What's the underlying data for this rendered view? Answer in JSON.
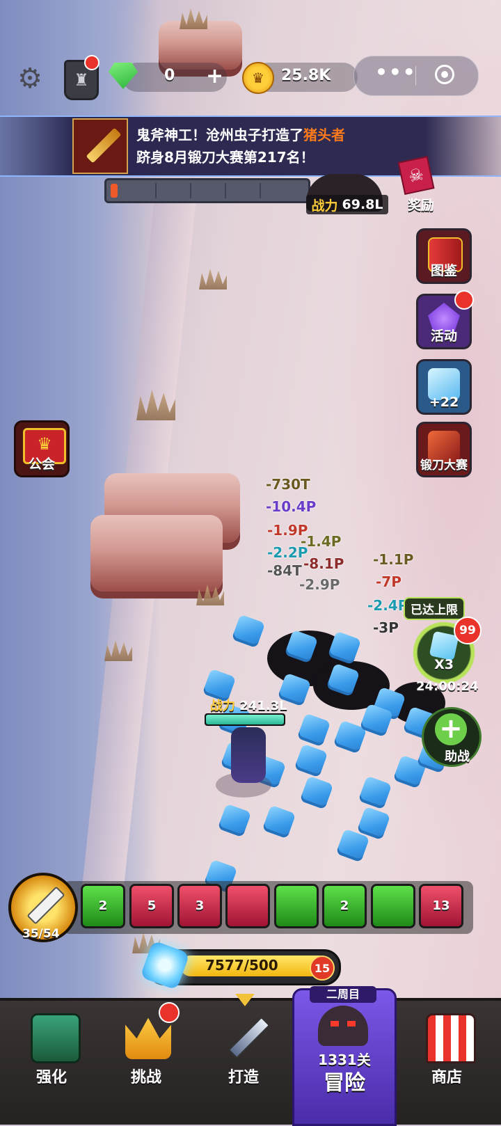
{
  "topbar": {
    "gems": "0",
    "gold": "25.8K"
  },
  "banner": {
    "line1_pre": "鬼斧神工！沧州虫子打造了",
    "line1_item": "猪头者",
    "line2": "跻身8月锻刀大赛第217名！"
  },
  "boss": {
    "power_label": "战力",
    "power_value": "69.8L",
    "reward_label": "奖励"
  },
  "side_buttons": {
    "codex": "图鉴",
    "events": "活动",
    "cubes_count": "+22",
    "forge_contest": "锻刀大赛",
    "guild": "公会"
  },
  "damage_numbers": [
    {
      "text": "-730T",
      "color": "#6b5a22"
    },
    {
      "text": "-10.4P",
      "color": "#6a3cc8"
    },
    {
      "text": "-1.9P",
      "color": "#c0392b"
    },
    {
      "text": "-1.4P",
      "color": "#6b6b22"
    },
    {
      "text": "-2.2P",
      "color": "#1c9ab0"
    },
    {
      "text": "-8.1P",
      "color": "#8e2c2c"
    },
    {
      "text": "-84T",
      "color": "#555555"
    },
    {
      "text": "-2.9P",
      "color": "#6a6a6a"
    },
    {
      "text": "-1.1P",
      "color": "#6b5a22"
    },
    {
      "text": "-7P",
      "color": "#c0392b"
    },
    {
      "text": "-2.4P",
      "color": "#1c9ab0"
    },
    {
      "text": "-3P",
      "color": "#333333"
    }
  ],
  "boost": {
    "cap_label": "已达上限",
    "multiplier": "X3",
    "badge": "99",
    "timer": "24:00:24",
    "assist_label": "助战"
  },
  "hero": {
    "power_label": "战力",
    "power_value": "241.3L",
    "hp_fraction": 1.0
  },
  "weapon": {
    "count": "35/54"
  },
  "skills": [
    {
      "type": "green",
      "level": "2"
    },
    {
      "type": "red",
      "level": "5"
    },
    {
      "type": "red",
      "level": "3"
    },
    {
      "type": "red",
      "level": ""
    },
    {
      "type": "green",
      "level": ""
    },
    {
      "type": "green",
      "level": "2"
    },
    {
      "type": "green",
      "level": ""
    },
    {
      "type": "red",
      "level": "13"
    }
  ],
  "energy": {
    "value": "7577/500",
    "level": "15"
  },
  "nav": {
    "enhance": "强化",
    "challenge": "挑战",
    "forge": "打造",
    "second_cycle": "二周目",
    "stage": "1331关",
    "adventure": "冒险",
    "shop": "商店"
  }
}
